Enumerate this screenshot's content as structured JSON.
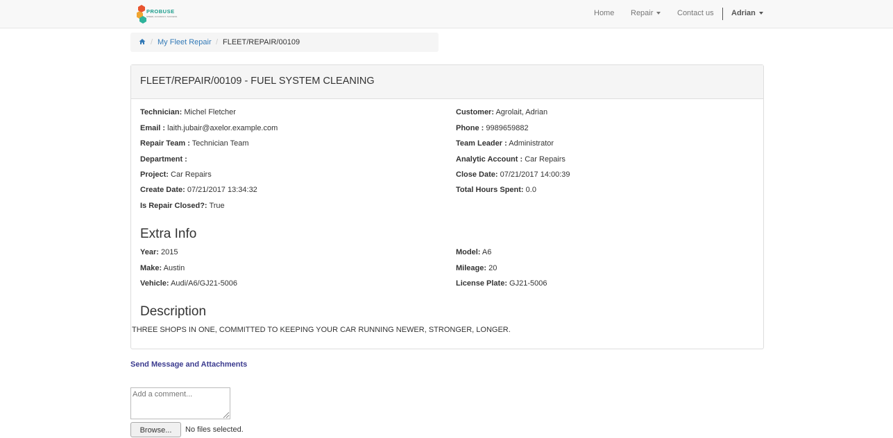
{
  "navbar": {
    "logo_text": "PROBUSE",
    "logo_sub": "SPEED, ACCURACY, SUCCESS",
    "home": "Home",
    "repair": "Repair",
    "contact": "Contact us",
    "user": "Adrian"
  },
  "breadcrumb": {
    "home_icon": "home-icon",
    "link": "My Fleet Repair",
    "current": "FLEET/REPAIR/00109"
  },
  "panel": {
    "title": "FLEET/REPAIR/00109 - FUEL SYSTEM CLEANING",
    "left": [
      {
        "label": "Technician:",
        "value": "Michel Fletcher"
      },
      {
        "label": "Email :",
        "value": "laith.jubair@axelor.example.com"
      },
      {
        "label": "Repair Team :",
        "value": "Technician Team"
      },
      {
        "label": "Department :",
        "value": ""
      },
      {
        "label": "Project:",
        "value": "Car Repairs"
      },
      {
        "label": "Create Date:",
        "value": "07/21/2017 13:34:32"
      },
      {
        "label": "Is Repair Closed?:",
        "value": "True"
      }
    ],
    "right": [
      {
        "label": "Customer:",
        "value": "Agrolait, Adrian"
      },
      {
        "label": "Phone :",
        "value": "9989659882"
      },
      {
        "label": "Team Leader :",
        "value": "Administrator"
      },
      {
        "label": "Analytic Account :",
        "value": "Car Repairs"
      },
      {
        "label": "Close Date:",
        "value": "07/21/2017 14:00:39"
      },
      {
        "label": "Total Hours Spent:",
        "value": "0.0"
      }
    ],
    "extra_title": "Extra Info",
    "extra_left": [
      {
        "label": "Year:",
        "value": "2015"
      },
      {
        "label": "Make:",
        "value": "Austin"
      },
      {
        "label": "Vehicle:",
        "value": "Audi/A6/GJ21-5006"
      }
    ],
    "extra_right": [
      {
        "label": "Model:",
        "value": "A6"
      },
      {
        "label": "Mileage:",
        "value": "20"
      },
      {
        "label": "License Plate:",
        "value": "GJ21-5006"
      }
    ],
    "description_title": "Description",
    "description": "THREE SHOPS IN ONE, COMMITTED TO KEEPING YOUR CAR RUNNING NEWER, STRONGER, LONGER."
  },
  "message": {
    "send_label": "Send Message and Attachments",
    "comment_placeholder": "Add a comment...",
    "browse_label": "Browse...",
    "no_files": "No files selected."
  }
}
